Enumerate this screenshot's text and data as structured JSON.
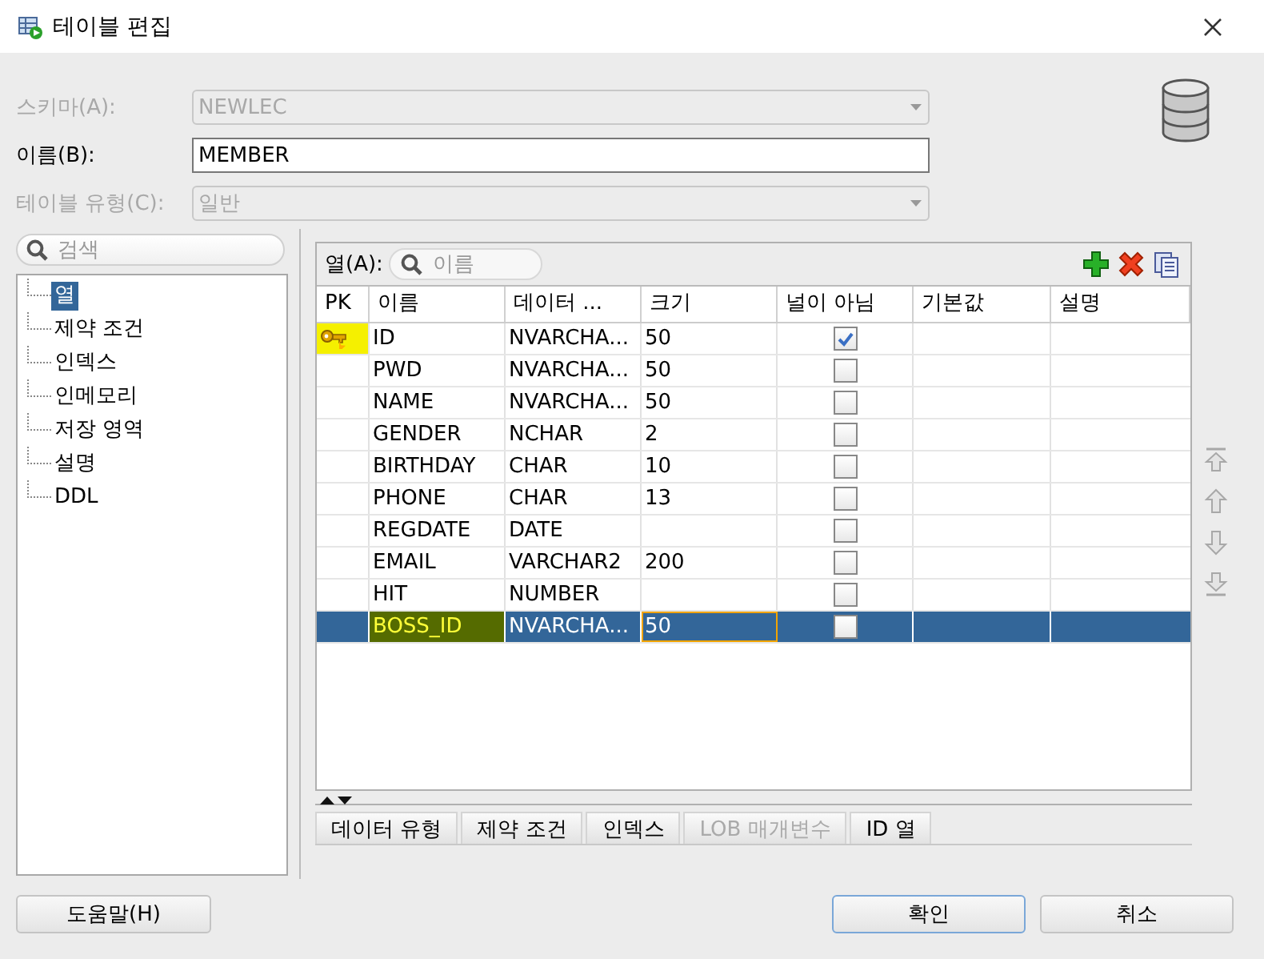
{
  "window": {
    "title": "테이블 편집"
  },
  "fields": [
    {
      "label": "스키마(A):",
      "value": "NEWLEC",
      "kind": "dropdown",
      "disabled": true
    },
    {
      "label": "이름(B):",
      "value": "MEMBER",
      "kind": "text",
      "disabled": false
    },
    {
      "label": "테이블 유형(C):",
      "value": "일반",
      "kind": "dropdown",
      "disabled": true
    }
  ],
  "sidebar": {
    "search": {
      "placeholder": "검색"
    },
    "items": [
      {
        "label": "열",
        "selected": true
      },
      {
        "label": "제약 조건",
        "selected": false
      },
      {
        "label": "인덱스",
        "selected": false
      },
      {
        "label": "인메모리",
        "selected": false
      },
      {
        "label": "저장 영역",
        "selected": false
      },
      {
        "label": "설명",
        "selected": false
      },
      {
        "label": "DDL",
        "selected": false
      }
    ]
  },
  "columns_panel": {
    "label": "열(A):",
    "filter": {
      "placeholder": "이름"
    },
    "table": {
      "columns": [
        "PK",
        "이름",
        "데이터 ...",
        "크기",
        "널이 아님",
        "기본값",
        "설명"
      ],
      "rows": [
        {
          "pk": true,
          "name": "ID",
          "data_type": "NVARCHA...",
          "size": "50",
          "not_null": true,
          "selected": false,
          "pk_highlighted": true,
          "name_highlighted": false
        },
        {
          "pk": false,
          "name": "PWD",
          "data_type": "NVARCHA...",
          "size": "50",
          "not_null": false,
          "selected": false,
          "pk_highlighted": false,
          "name_highlighted": false
        },
        {
          "pk": false,
          "name": "NAME",
          "data_type": "NVARCHA...",
          "size": "50",
          "not_null": false,
          "selected": false,
          "pk_highlighted": false,
          "name_highlighted": false
        },
        {
          "pk": false,
          "name": "GENDER",
          "data_type": "NCHAR",
          "size": "2",
          "not_null": false,
          "selected": false,
          "pk_highlighted": false,
          "name_highlighted": false
        },
        {
          "pk": false,
          "name": "BIRTHDAY",
          "data_type": "CHAR",
          "size": "10",
          "not_null": false,
          "selected": false,
          "pk_highlighted": false,
          "name_highlighted": false
        },
        {
          "pk": false,
          "name": "PHONE",
          "data_type": "CHAR",
          "size": "13",
          "not_null": false,
          "selected": false,
          "pk_highlighted": false,
          "name_highlighted": false
        },
        {
          "pk": false,
          "name": "REGDATE",
          "data_type": "DATE",
          "not_null": false,
          "selected": false,
          "pk_highlighted": false,
          "name_highlighted": false
        },
        {
          "pk": false,
          "name": "EMAIL",
          "data_type": "VARCHAR2",
          "size": "200",
          "not_null": false,
          "selected": false,
          "pk_highlighted": false,
          "name_highlighted": false
        },
        {
          "pk": false,
          "name": "HIT",
          "data_type": "NUMBER",
          "not_null": false,
          "selected": false,
          "pk_highlighted": false,
          "name_highlighted": false
        },
        {
          "pk": false,
          "name": "BOSS_ID",
          "data_type": "NVARCHA...",
          "size": "50",
          "not_null": false,
          "selected": true,
          "pk_highlighted": false,
          "name_highlighted": true
        }
      ]
    }
  },
  "bottom_tabs": [
    {
      "label": "데이터 유형",
      "disabled": false
    },
    {
      "label": "제약 조건",
      "disabled": false
    },
    {
      "label": "인덱스",
      "disabled": false
    },
    {
      "label": "LOB 매개변수",
      "disabled": true
    },
    {
      "label": "ID 열",
      "disabled": false
    }
  ],
  "buttons": [
    {
      "label": "도움말(H)",
      "default": false
    },
    {
      "label": "확인",
      "default": true
    },
    {
      "label": "취소",
      "default": false
    }
  ]
}
